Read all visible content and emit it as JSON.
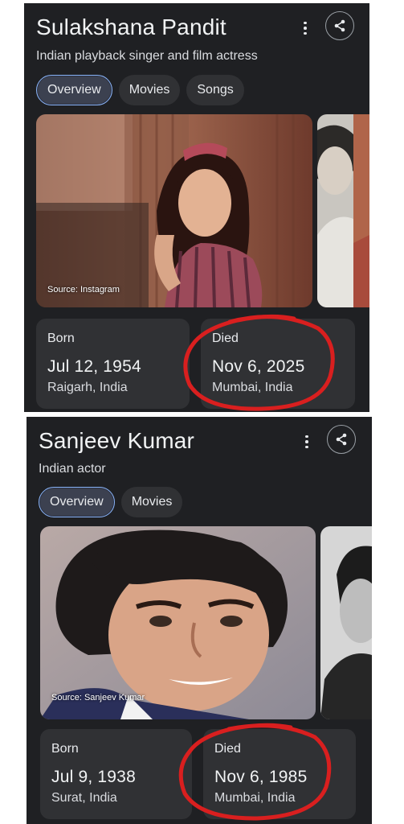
{
  "panels": [
    {
      "title": "Sulakshana Pandit",
      "subtitle": "Indian playback singer and film actress",
      "menu_icon": "more-vert-icon",
      "share_icon": "share-icon",
      "tabs": [
        {
          "label": "Overview",
          "active": true
        },
        {
          "label": "Movies",
          "active": false
        },
        {
          "label": "Songs",
          "active": false
        }
      ],
      "photo_source": "Source: Instagram",
      "born": {
        "label": "Born",
        "date": "Jul 12, 1954",
        "place": "Raigarh, India"
      },
      "died": {
        "label": "Died",
        "date": "Nov 6, 2025",
        "place": "Mumbai, India"
      }
    },
    {
      "title": "Sanjeev Kumar",
      "subtitle": "Indian actor",
      "menu_icon": "more-vert-icon",
      "share_icon": "share-icon",
      "tabs": [
        {
          "label": "Overview",
          "active": true
        },
        {
          "label": "Movies",
          "active": false
        }
      ],
      "photo_source": "Source: Sanjeev Kumar",
      "born": {
        "label": "Born",
        "date": "Jul 9, 1938",
        "place": "Surat, India"
      },
      "died": {
        "label": "Died",
        "date": "Nov 6, 1985",
        "place": "Mumbai, India"
      }
    }
  ],
  "colors": {
    "panel_bg": "#1f2023",
    "card_bg": "#303134",
    "active_chip_border": "#8ab4f8",
    "annotation_red": "#d91f1f"
  }
}
